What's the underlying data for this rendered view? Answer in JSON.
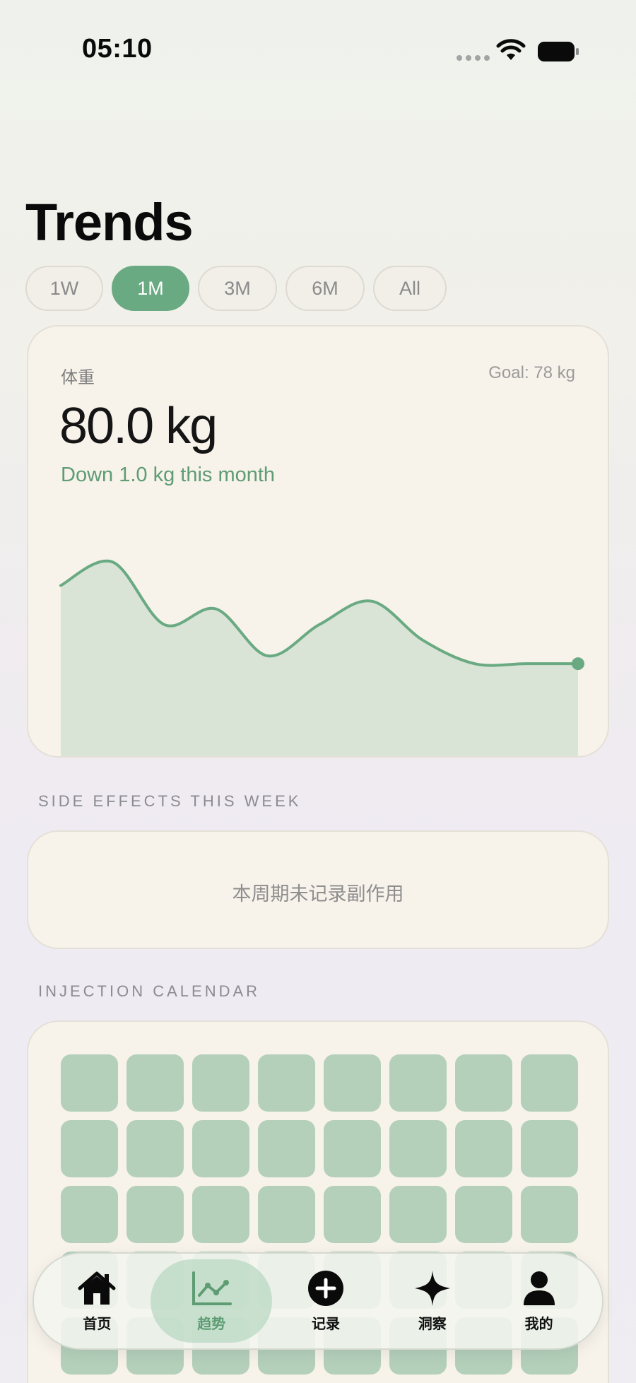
{
  "status_bar": {
    "time": "05:10"
  },
  "header": {
    "title": "Trends"
  },
  "periods": [
    {
      "label": "1W",
      "active": false
    },
    {
      "label": "1M",
      "active": true
    },
    {
      "label": "3M",
      "active": false
    },
    {
      "label": "6M",
      "active": false
    },
    {
      "label": "All",
      "active": false
    }
  ],
  "weight_card": {
    "label": "体重",
    "goal": "Goal: 78 kg",
    "value": "80.0 kg",
    "delta": "Down 1.0 kg this month"
  },
  "chart_data": {
    "type": "area",
    "title": "",
    "xlabel": "",
    "ylabel": "",
    "x": [
      0,
      1,
      2,
      3,
      4,
      5,
      6,
      7,
      8,
      9,
      10
    ],
    "values": [
      81.0,
      81.3,
      80.5,
      80.7,
      80.1,
      80.5,
      80.8,
      80.3,
      80.0,
      80.0,
      80.0
    ],
    "ylim": [
      78.8,
      81.6
    ],
    "grid": false,
    "legend": "none",
    "line_color": "#6aaa83",
    "fill_color": "#d9e4d6"
  },
  "side_effects": {
    "section_label": "SIDE EFFECTS THIS WEEK",
    "empty_text": "本周期未记录副作用"
  },
  "calendar": {
    "section_label": "INJECTION CALENDAR",
    "cell_count": 48,
    "cell_color": "#b4d0bb"
  },
  "tab_bar": {
    "items": [
      {
        "label": "首页",
        "icon": "house-icon",
        "active": false
      },
      {
        "label": "趋势",
        "icon": "trend-chart-icon",
        "active": true
      },
      {
        "label": "记录",
        "icon": "plus-circle-icon",
        "active": false
      },
      {
        "label": "洞察",
        "icon": "sparkle-icon",
        "active": false
      },
      {
        "label": "我的",
        "icon": "person-icon",
        "active": false
      }
    ]
  },
  "colors": {
    "accent": "#6aaa83",
    "accent_text": "#5e9c74",
    "card_bg": "#f7f2ea"
  }
}
